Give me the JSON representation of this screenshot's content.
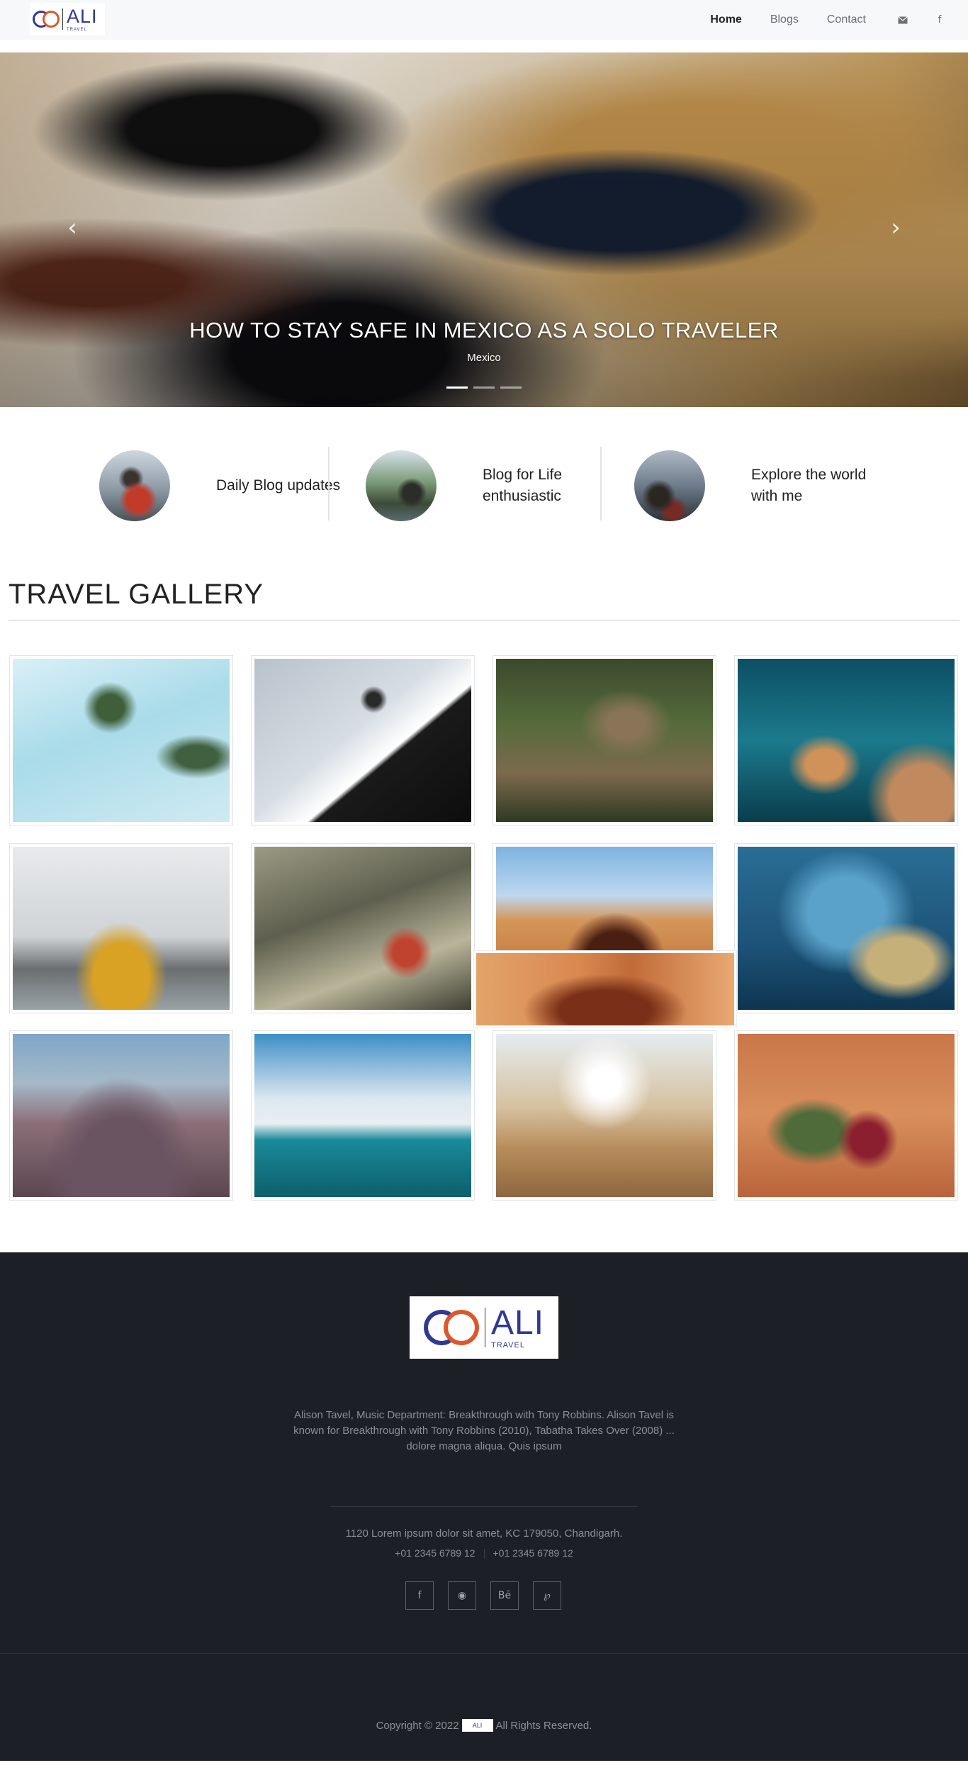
{
  "brand": {
    "name": "ALI",
    "tagline": "TRAVEL"
  },
  "nav": {
    "links": [
      "Home",
      "Blogs",
      "Contact"
    ],
    "active": "Home",
    "icons": [
      "envelope-icon",
      "facebook-icon"
    ]
  },
  "hero": {
    "title": "HOW TO STAY SAFE IN MEXICO AS A SOLO TRAVELER",
    "subtitle": "Mexico",
    "prev_symbol": "‹",
    "next_symbol": "›",
    "slides": 3,
    "active_slide": 1
  },
  "features": [
    {
      "text": "Daily Blog updates"
    },
    {
      "text": "Blog for Life enthusiastic"
    },
    {
      "text": "Explore the world with me"
    }
  ],
  "gallery": {
    "title": "TRAVEL GALLERY",
    "items": [
      "palm-trees",
      "skater-jump",
      "tree-branches",
      "diver-fins",
      "person-yellow-jacket",
      "hiker-grass",
      "canyon-jump",
      "wave-surfer",
      "skatepark",
      "ocean-surfer",
      "desert-walker",
      "canyon-sitter"
    ]
  },
  "footer": {
    "about": "Alison Tavel, Music Department: Breakthrough with Tony Robbins. Alison Tavel is known for Breakthrough with Tony Robbins (2010), Tabatha Takes Over (2008) ... dolore magna aliqua. Quis ipsum",
    "address": "1120 Lorem ipsum dolor sit amet, KC 179050, Chandigarh.",
    "phone1": "+01 2345 6789 12",
    "phone2": "+01 2345 6789 12",
    "socials": [
      {
        "name": "facebook-icon",
        "glyph": "f"
      },
      {
        "name": "github-icon",
        "glyph": "◉"
      },
      {
        "name": "behance-icon",
        "glyph": "Bē"
      },
      {
        "name": "pinterest-icon",
        "glyph": "℘"
      }
    ],
    "copyright_pre": "Copyright © 2022",
    "copyright_post": "All Rights Reserved."
  },
  "colors": {
    "accent": "#2f3a8f",
    "orange": "#e0562b",
    "footer_bg": "#1c1f26"
  }
}
